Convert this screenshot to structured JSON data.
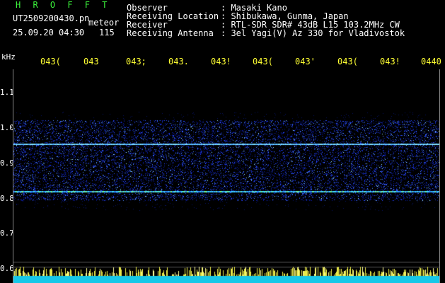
{
  "header": {
    "brand": "H R O F F T",
    "filename": "UT2509200430.pn",
    "filename_suffix": "meteor",
    "datetime": "25.09.20 04:30",
    "count": "115"
  },
  "meta": [
    {
      "label": "Observer",
      "value": ": Masaki Kano"
    },
    {
      "label": "Receiving Location",
      "value": ": Shibukawa, Gunma, Japan"
    },
    {
      "label": "Receiver",
      "value": ": RTL-SDR SDR# 43dB L15 103.2MHz CW"
    },
    {
      "label": "Receiving Antenna",
      "value": ": 3el Yagi(V) Az 330 for Vladivostok"
    }
  ],
  "axis": {
    "unit": "kHz",
    "x_ticks": [
      "043(",
      "043",
      "043;",
      "043.",
      "043!",
      "043(",
      "043'",
      "043(",
      "043!",
      "0440"
    ],
    "y_ticks": [
      "1.1",
      "1.0",
      "0.9",
      "0.8",
      "0.7",
      "0.6"
    ]
  },
  "colors": {
    "header_green": "#3cf53c",
    "tick_yellow": "#ffff33",
    "noise_blue": "#2a4cff",
    "line_cyan": "#7fe0ff",
    "baseline_cyan": "#16c8e8"
  }
}
